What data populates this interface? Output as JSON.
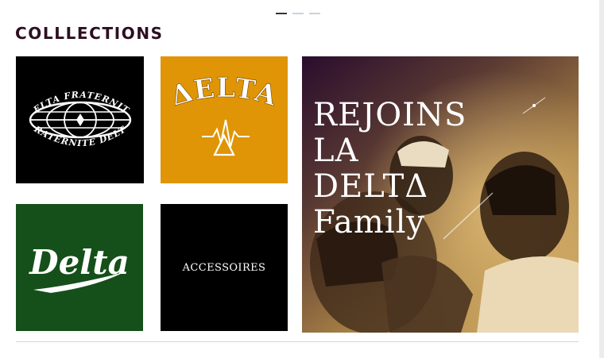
{
  "carousel": {
    "pages": 3,
    "active": 1
  },
  "section": {
    "title": "COLLLECTIONS"
  },
  "collections": [
    {
      "name": "delta-fraternite",
      "logo_text_top": "DELTA FRATERNITE",
      "logo_text_bottom": "FRATERNITE DELTA"
    },
    {
      "name": "delta-orange",
      "logo_text": "ΔELTA"
    },
    {
      "name": "delta-green",
      "logo_text": "Delta"
    },
    {
      "name": "accessoires",
      "label": "ACCESSOIRES"
    }
  ],
  "banner": {
    "lines": [
      "REJOINS",
      "LA",
      "DELTΔ",
      "Family"
    ]
  },
  "colors": {
    "title": "#2d0f22",
    "orange": "#df9506",
    "green": "#15501a",
    "black": "#000000"
  }
}
